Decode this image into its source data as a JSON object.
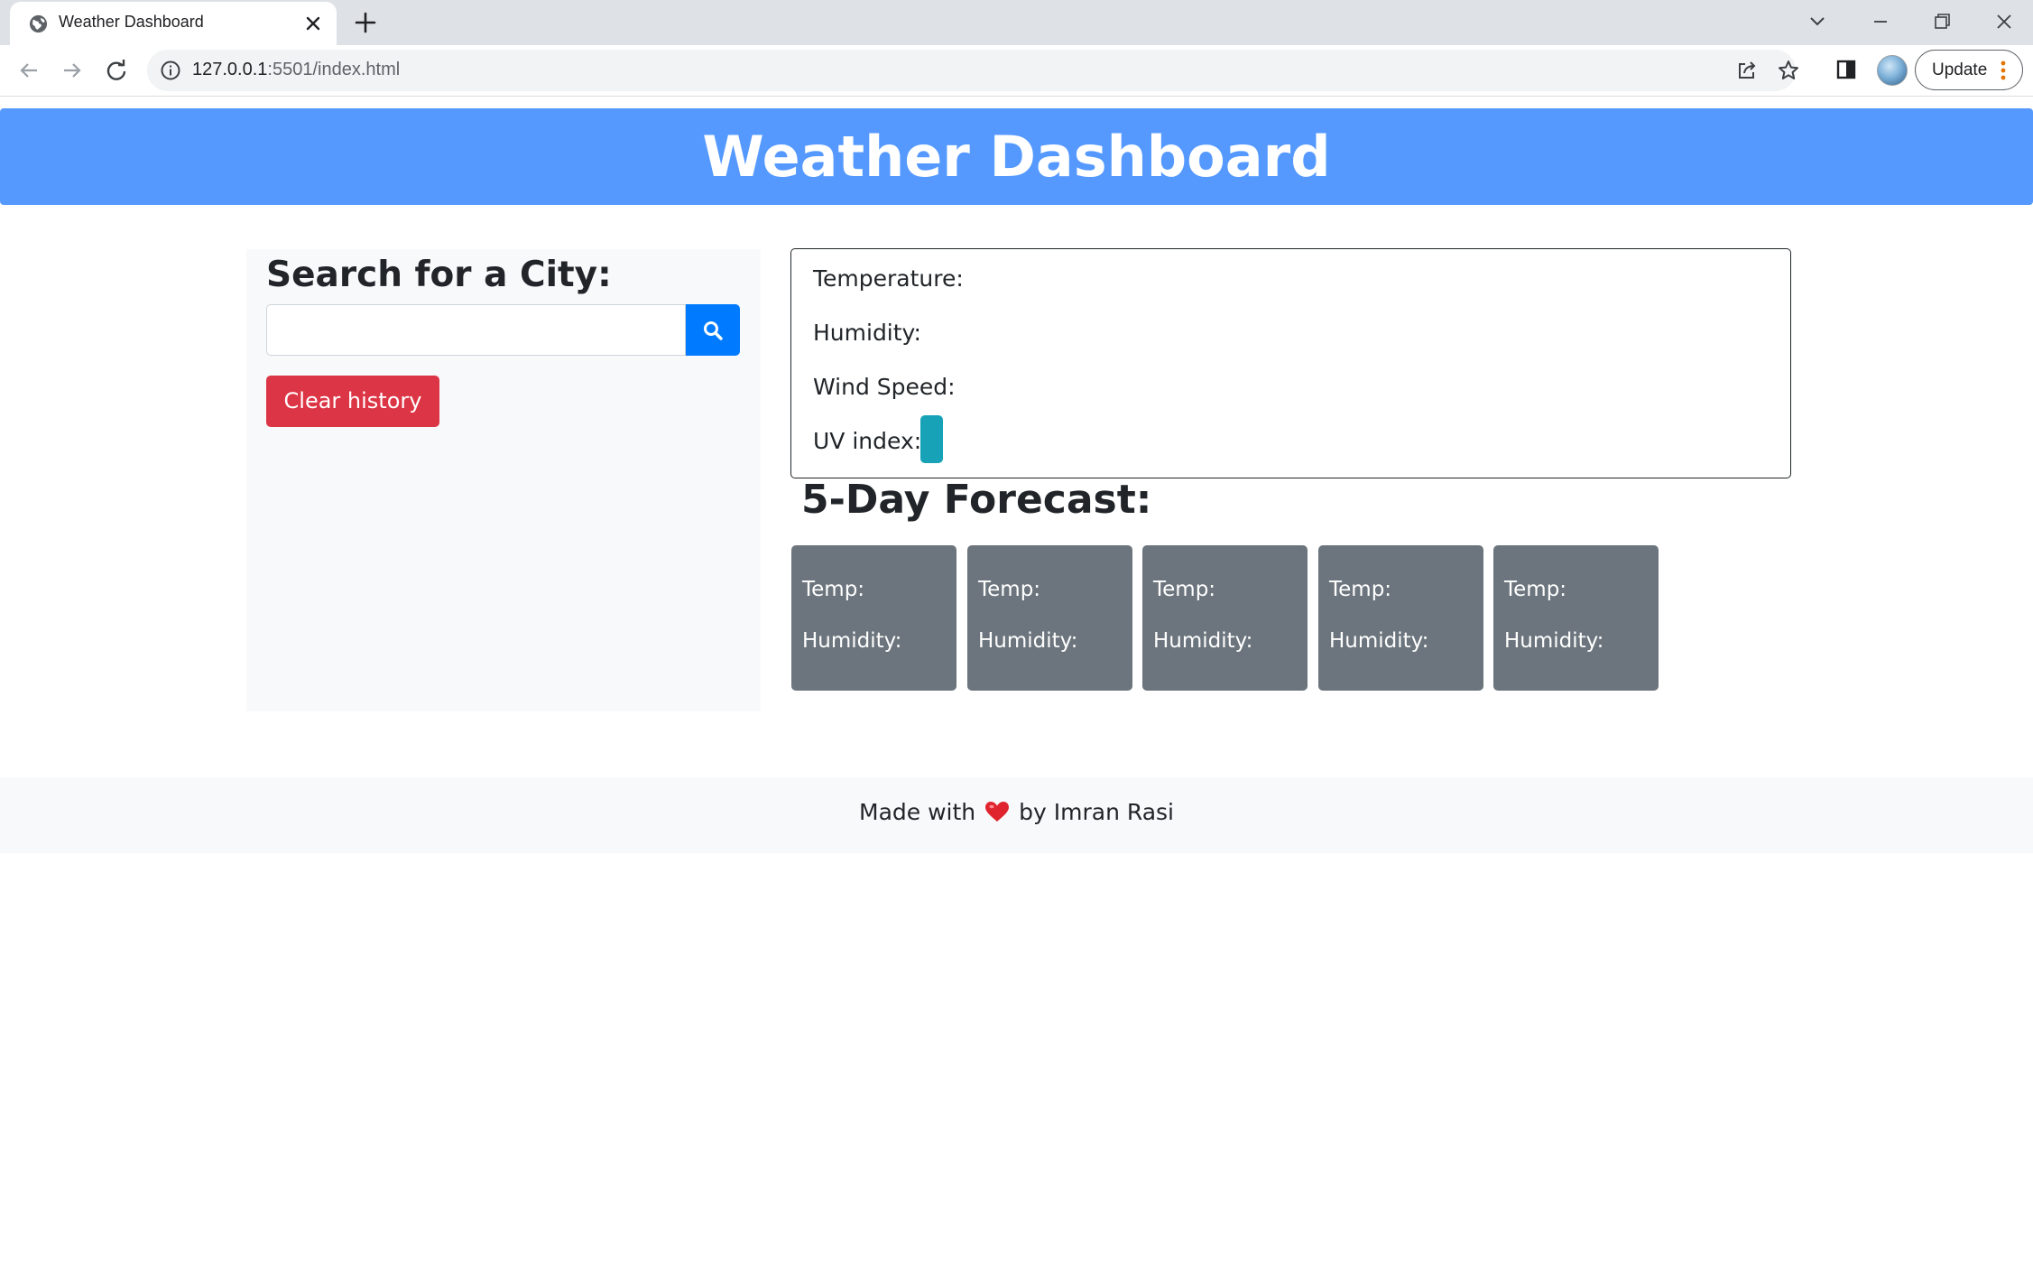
{
  "browser": {
    "tab_title": "Weather Dashboard",
    "url_host": "127.0.0.1",
    "url_path": ":5501/index.html",
    "update_label": "Update",
    "icons": [
      "globe-icon",
      "close-icon",
      "plus-icon",
      "chevron-down-icon",
      "minimize-icon",
      "restore-icon",
      "window-close-icon",
      "back-arrow-icon",
      "forward-arrow-icon",
      "reload-icon",
      "info-icon",
      "share-icon",
      "star-icon",
      "side-panel-icon",
      "profile-avatar",
      "kebab-menu-icon"
    ]
  },
  "header": {
    "title": "Weather Dashboard",
    "background": "#5599ff"
  },
  "sidebar": {
    "heading": "Search for a City:",
    "search_value": "",
    "search_icon": "search-icon",
    "search_button_color": "#007bff",
    "clear_label": "Clear history",
    "clear_color": "#dc3545"
  },
  "current": {
    "temperature_label": "Temperature:",
    "humidity_label": "Humidity:",
    "wind_label": "Wind Speed:",
    "uv_label": "UV index:",
    "uv_badge_color": "#17a2b8"
  },
  "forecast": {
    "title": "5-Day Forecast:",
    "card_color": "#6c757d",
    "cards": [
      {
        "temp": "Temp:",
        "humidity": "Humidity:"
      },
      {
        "temp": "Temp:",
        "humidity": "Humidity:"
      },
      {
        "temp": "Temp:",
        "humidity": "Humidity:"
      },
      {
        "temp": "Temp:",
        "humidity": "Humidity:"
      },
      {
        "temp": "Temp:",
        "humidity": "Humidity:"
      }
    ]
  },
  "footer": {
    "before": "Made with",
    "icon": "heart-icon",
    "after": "by Imran Rasi"
  }
}
